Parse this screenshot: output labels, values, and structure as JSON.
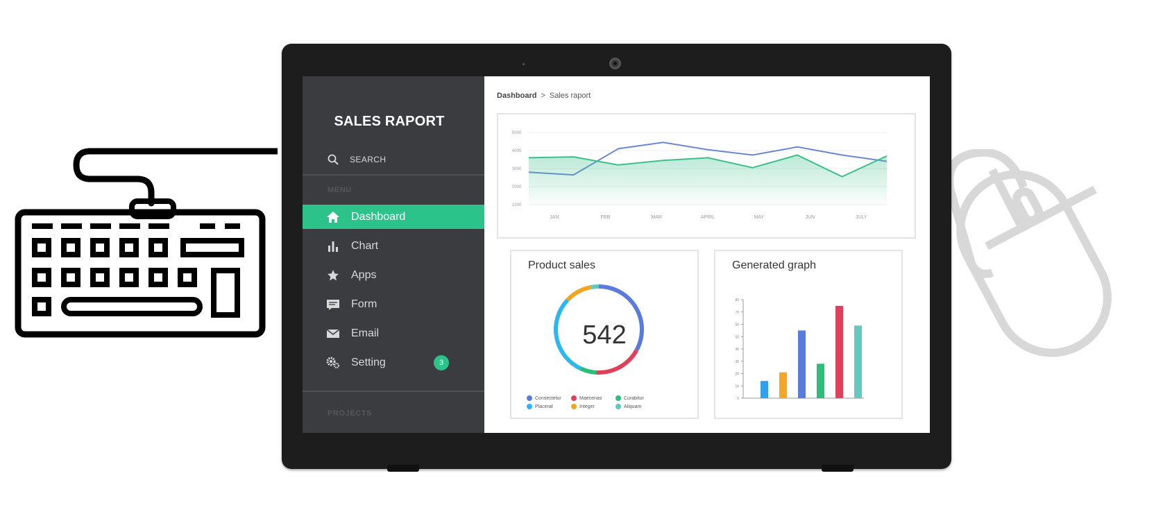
{
  "app": {
    "title": "SALES RAPORT"
  },
  "search": {
    "label": "SEARCH"
  },
  "sidebar": {
    "menu_label": "MENU",
    "projects_label": "PROJECTS",
    "items": [
      {
        "label": "Dashboard",
        "icon": "home-icon",
        "active": true
      },
      {
        "label": "Chart",
        "icon": "bar-chart-icon"
      },
      {
        "label": "Apps",
        "icon": "star-icon"
      },
      {
        "label": "Form",
        "icon": "form-icon"
      },
      {
        "label": "Email",
        "icon": "envelope-icon"
      },
      {
        "label": "Setting",
        "icon": "gears-icon",
        "badge": "3"
      }
    ]
  },
  "breadcrumb": {
    "root": "Dashboard",
    "separator": ">",
    "current": "Sales raport"
  },
  "colors": {
    "accent": "#2bc38a",
    "sidebar_bg": "#3b3c3f",
    "blue_series": "#6a86d8",
    "green_series": "#3cbf8a"
  },
  "chart_data": [
    {
      "type": "line",
      "x": [
        "JAN",
        "FEB",
        "MAR",
        "APRIL",
        "MAY",
        "JUN",
        "JULY"
      ],
      "ylim": [
        1000,
        5000
      ],
      "yticks": [
        "5000",
        "4000",
        "3000",
        "2000",
        "1000"
      ],
      "grid": true,
      "series": [
        {
          "values": [
            2800,
            2650,
            4100,
            4450,
            4050,
            3750,
            4200,
            3750,
            3400
          ],
          "color": "#6a86d8"
        },
        {
          "values": [
            3600,
            3650,
            3200,
            3450,
            3600,
            3050,
            3750,
            2550,
            3700
          ],
          "color": "#3cbf8a",
          "fill": "area"
        }
      ]
    },
    {
      "type": "pie",
      "title": "Product sales",
      "center_value": "542",
      "labels": [
        "Consectetur",
        "Maecenas",
        "Curabitur",
        "Placerat",
        "Integer",
        "Aliquam"
      ],
      "values": [
        33,
        18,
        6,
        30,
        10,
        3
      ],
      "colors": [
        "#5b7bdc",
        "#e0405a",
        "#2bbf7a",
        "#2bb8ef",
        "#f2a51e",
        "#62c8c0"
      ]
    },
    {
      "type": "bar",
      "title": "Generated graph",
      "values": [
        14,
        21,
        55,
        28,
        75,
        59
      ],
      "colors": [
        "#2f9ff0",
        "#f5a623",
        "#5b7bdc",
        "#2bbf7a",
        "#e0405a",
        "#62c8c0"
      ],
      "ylim": [
        0,
        80
      ],
      "yticks": [
        "80",
        "70",
        "60",
        "50",
        "40",
        "30",
        "20",
        "10",
        "0"
      ]
    }
  ]
}
